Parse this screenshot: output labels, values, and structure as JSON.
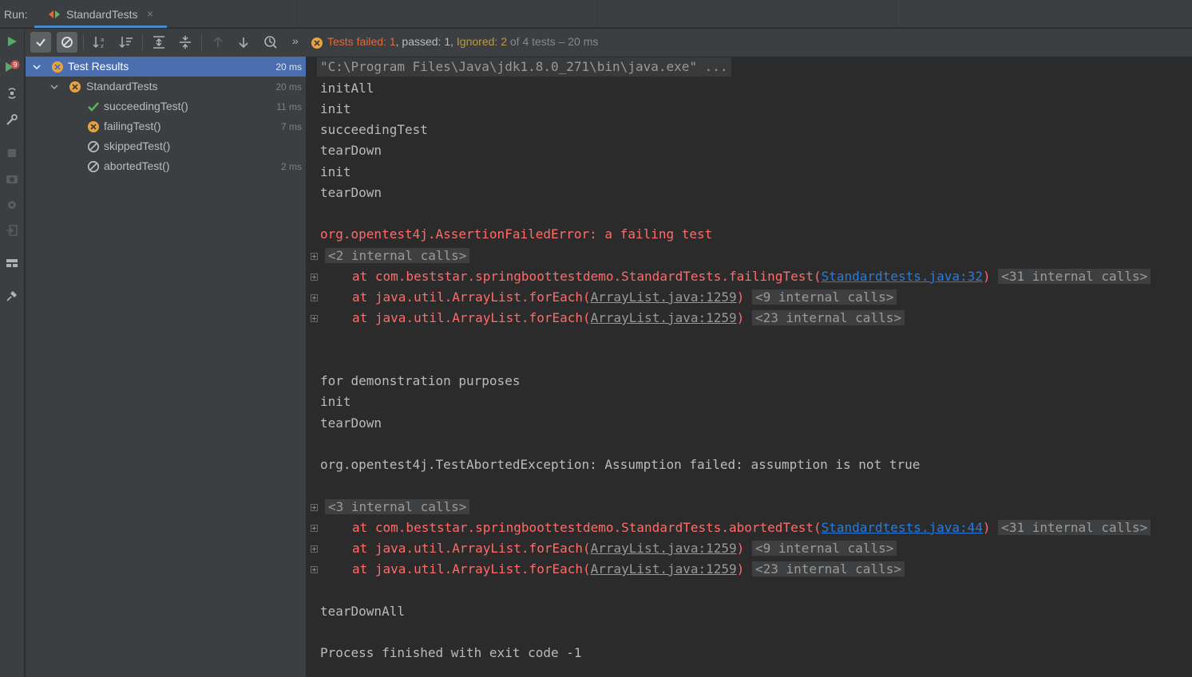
{
  "tabbar": {
    "run_label": "Run:",
    "tab_label": "StandardTests",
    "close_glyph": "×"
  },
  "toolbar": {
    "status": {
      "failed_label": "Tests failed:",
      "failed_count": "1",
      "passed_label": ", passed:",
      "passed_count": "1",
      "comma": ",",
      "ignored_label": "Ignored:",
      "ignored_count": "2",
      "of_total": "of 4 tests – 20 ms"
    },
    "more_glyph": "»"
  },
  "tree": {
    "items": [
      {
        "name": "Test Results",
        "time": "20 ms",
        "status": "failed"
      },
      {
        "name": "StandardTests",
        "time": "20 ms",
        "status": "failed"
      },
      {
        "name": "succeedingTest()",
        "time": "11 ms",
        "status": "passed"
      },
      {
        "name": "failingTest()",
        "time": "7 ms",
        "status": "failed"
      },
      {
        "name": "skippedTest()",
        "time": "",
        "status": "ignored"
      },
      {
        "name": "abortedTest()",
        "time": "2 ms",
        "status": "ignored"
      }
    ]
  },
  "console": {
    "cmd": "\"C:\\Program Files\\Java\\jdk1.8.0_271\\bin\\java.exe\" ...",
    "l_initAll": "initAll",
    "l_init1": "init",
    "l_succeeding": "succeedingTest",
    "l_teardown1": "tearDown",
    "l_init2": "init",
    "l_teardown2": "tearDown",
    "err1": "org.opentest4j.AssertionFailedError: a failing test",
    "int1": "<2 internal calls>",
    "st1_at": "at com.beststar.springboottestdemo.StandardTests.failingTest(",
    "st1_link": "Standardtests.java:32",
    "st1_close": ")",
    "st1_int": "<31 internal calls>",
    "st2_at": "at java.util.ArrayList.forEach(",
    "st2_link": "ArrayList.java:1259",
    "st2_close": ")",
    "st2_int": "<9 internal calls>",
    "st3_at": "at java.util.ArrayList.forEach(",
    "st3_link": "ArrayList.java:1259",
    "st3_close": ")",
    "st3_int": "<23 internal calls>",
    "l_demo": "for demonstration purposes",
    "l_init3": "init",
    "l_teardown3": "tearDown",
    "err2": "org.opentest4j.TestAbortedException: Assumption failed: assumption is not true",
    "int2": "<3 internal calls>",
    "st4_at": "at com.beststar.springboottestdemo.StandardTests.abortedTest(",
    "st4_link": "Standardtests.java:44",
    "st4_close": ")",
    "st4_int": "<31 internal calls>",
    "st5_at": "at java.util.ArrayList.forEach(",
    "st5_link": "ArrayList.java:1259",
    "st5_close": ")",
    "st5_int": "<9 internal calls>",
    "st6_at": "at java.util.ArrayList.forEach(",
    "st6_link": "ArrayList.java:1259",
    "st6_close": ")",
    "st6_int": "<23 internal calls>",
    "l_teardownall": "tearDownAll",
    "l_exit": "Process finished with exit code -1"
  },
  "colors": {
    "accent": "#4b6eaf",
    "error": "#ff6b68",
    "passed": "#5fb85f",
    "failed": "#e8a33e",
    "link": "#287bde"
  },
  "icons": [
    "rerun-icon",
    "rerun-failed-icon",
    "toggle-auto-test-icon",
    "settings-icon",
    "stop-icon",
    "camera-icon",
    "gear-icon",
    "exit-icon",
    "layout-icon",
    "pin-icon",
    "show-passed-icon",
    "show-ignored-icon",
    "sort-alpha-icon",
    "sort-duration-icon",
    "expand-all-icon",
    "collapse-all-icon",
    "previous-failed-icon",
    "next-failed-icon",
    "history-icon"
  ]
}
